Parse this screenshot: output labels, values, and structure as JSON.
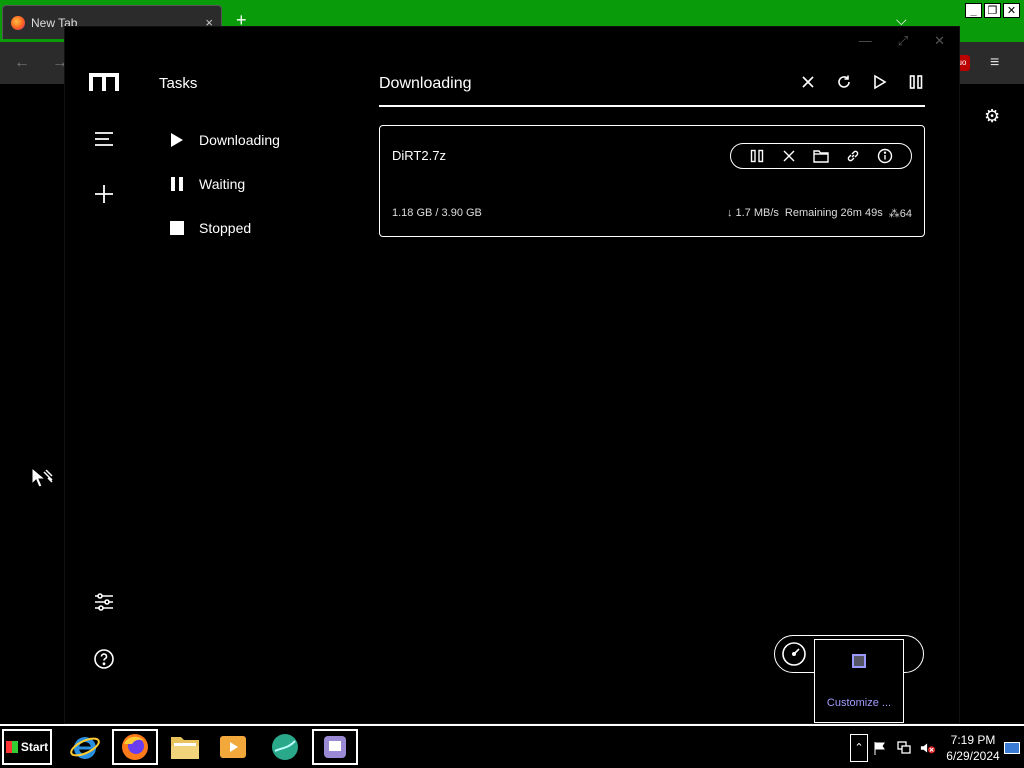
{
  "browser": {
    "tab_title": "New Tab",
    "tab_close": "×",
    "new_tab": "+",
    "chevron": "⌵",
    "win_min": "_",
    "win_restore": "❐",
    "win_close": "✕",
    "back": "←",
    "forward": "→",
    "menu": "≡",
    "ublock_badge": "uo"
  },
  "app": {
    "tasks_title": "Tasks",
    "filters": [
      {
        "label": "Downloading",
        "icon": "play-icon"
      },
      {
        "label": "Waiting",
        "icon": "pause-icon"
      },
      {
        "label": "Stopped",
        "icon": "stop-icon"
      }
    ],
    "main_title": "Downloading",
    "task": {
      "name": "DiRT2.7z",
      "progress": "1.18 GB / 3.90 GB",
      "speed": "↓ 1.7 MB/s",
      "remaining": "Remaining 26m 49s",
      "connections": "64",
      "progress_fraction": 0.3026
    }
  },
  "tray_popup": {
    "customize": "Customize ..."
  },
  "taskbar": {
    "start": "Start",
    "clock_time": "7:19 PM",
    "clock_date": "6/29/2024",
    "tray_chevron": "⌃"
  },
  "colors": {
    "accent_green": "#0a9b0a",
    "popup_link": "#a39bff"
  }
}
